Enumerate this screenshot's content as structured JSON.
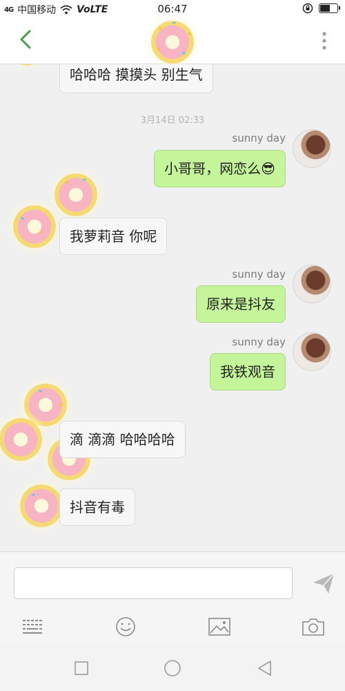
{
  "status_bar": {
    "signal": "4G",
    "carrier": "中国移动",
    "network": "VoLTE",
    "time": "06:47"
  },
  "header": {
    "back_icon": "chevron-left-icon",
    "more_icon": "more-vertical-icon"
  },
  "messages": [
    {
      "side": "in",
      "text": "哈哈哈 摸摸头 别生气"
    },
    {
      "timestamp": "3月14日 02:33"
    },
    {
      "side": "out",
      "nickname": "sunny day",
      "text": "小哥哥，网恋么😎"
    },
    {
      "side": "in",
      "text": "我萝莉音 你呢"
    },
    {
      "side": "out",
      "nickname": "sunny day",
      "text": "原来是抖友"
    },
    {
      "side": "out",
      "nickname": "sunny day",
      "text": "我铁观音"
    },
    {
      "side": "in",
      "text": "滴 滴滴 哈哈哈哈"
    },
    {
      "side": "in",
      "text": "抖音有毒"
    }
  ],
  "input": {
    "value": "",
    "placeholder": ""
  },
  "toolbar": [
    "keyboard-icon",
    "emoji-icon",
    "image-icon",
    "camera-icon"
  ],
  "navbar": [
    "recent-apps-icon",
    "home-icon",
    "back-icon"
  ],
  "colors": {
    "accent": "#4caf50",
    "outgoing_bubble": "#c5f59a",
    "incoming_bubble": "#f7f7f7"
  }
}
